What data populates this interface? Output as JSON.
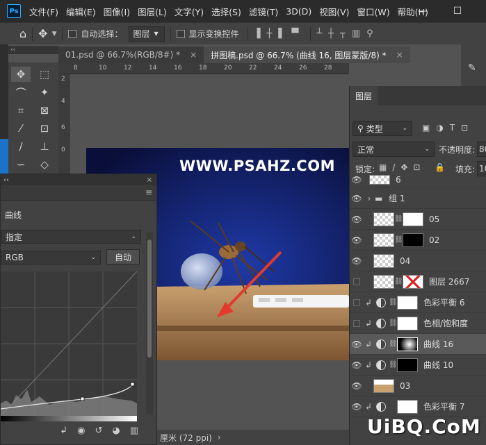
{
  "app": {
    "logo": "Ps"
  },
  "menu": [
    "文件(F)",
    "编辑(E)",
    "图像(I)",
    "图层(L)",
    "文字(Y)",
    "选择(S)",
    "滤镜(T)",
    "3D(D)",
    "视图(V)",
    "窗口(W)",
    "帮助(H)"
  ],
  "window_controls": {
    "minimize": "—",
    "maximize": "☐"
  },
  "options": {
    "auto_select_label": "自动选择：",
    "auto_select_value": "图层",
    "show_transform_label": "显示变换控件"
  },
  "tabs": [
    {
      "label": "01.psd @ 66.7%(RGB/8#) *",
      "close": "×"
    },
    {
      "label": "拼图稿.psd @ 66.7% (曲线 16, 图层蒙版/8) *",
      "close": "×"
    }
  ],
  "toolbar_collapse": "‹‹",
  "ruler_top": [
    "8",
    "10",
    "12",
    "14",
    "16",
    "18",
    "20",
    "22",
    "24",
    "26",
    "28",
    "30"
  ],
  "ruler_left": [
    "2",
    "4",
    "6",
    "0"
  ],
  "canvas": {
    "watermark": "WWW.PSAHZ.COM"
  },
  "curves": {
    "panel_menu": "≡",
    "collapse": "‹‹",
    "close": "×",
    "title": "曲线",
    "preset": "指定",
    "channel": "RGB",
    "auto_button": "自动"
  },
  "layers_panel": {
    "tab": "图层",
    "filter_kind": "类型",
    "blend_mode": "正常",
    "opacity_label": "不透明度:",
    "opacity_value": "80",
    "lock_label": "锁定:",
    "fill_label": "填充:",
    "fill_value": "10",
    "rows": [
      {
        "name": "6"
      },
      {
        "name": "组 1"
      },
      {
        "name": "05"
      },
      {
        "name": "02"
      },
      {
        "name": "04"
      },
      {
        "name": "图层 2667"
      },
      {
        "name": "色彩平衡 6"
      },
      {
        "name": "色相/饱和度"
      },
      {
        "name": "曲线 16"
      },
      {
        "name": "曲线 10"
      },
      {
        "name": "03"
      },
      {
        "name": "色彩平衡 7"
      }
    ]
  },
  "status_bar": {
    "text": "厘米 (72 ppi)",
    "arrow": "›"
  },
  "site_watermark": "UiBQ.CoM"
}
